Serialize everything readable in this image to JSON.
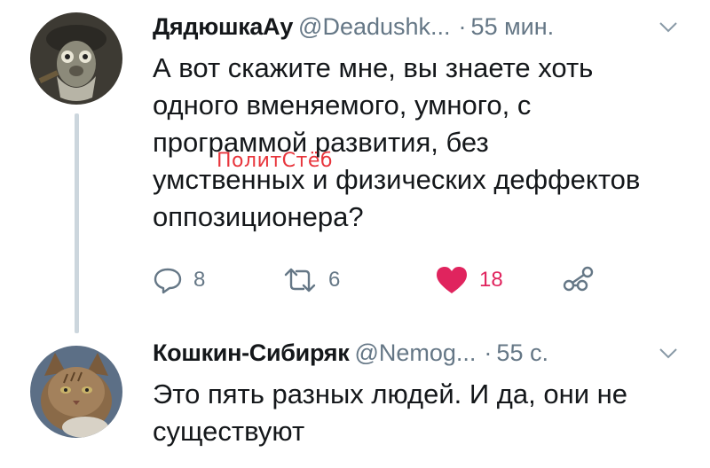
{
  "tweets": [
    {
      "display_name": "ДядюшкаАу",
      "handle": "@Deadushk...",
      "separator": "·",
      "time": "55 мин.",
      "text": "А вот скажите мне, вы знаете хоть\nодного вменяемого, умного, с\nпрограммой развития, без\nумственных и физических деффектов\noппозиционера?",
      "actions": {
        "reply_count": "8",
        "retweet_count": "6",
        "like_count": "18"
      },
      "icons": [
        "reply-icon",
        "retweet-icon",
        "heart-icon",
        "share-icon",
        "chevron-down-icon"
      ]
    },
    {
      "display_name": "Кошкин-Сибиряк",
      "handle": "@Nemog...",
      "separator": "·",
      "time": "55 с.",
      "text": "Это пять разных людей. И да, они не\nсуществуют",
      "icons": [
        "chevron-down-icon"
      ]
    }
  ],
  "watermark": "ПолитСтёб",
  "colors": {
    "text": "#14171a",
    "secondary": "#657786",
    "like": "#e0245e",
    "thread_line": "#ccd6dd",
    "watermark": "#e8353c"
  }
}
